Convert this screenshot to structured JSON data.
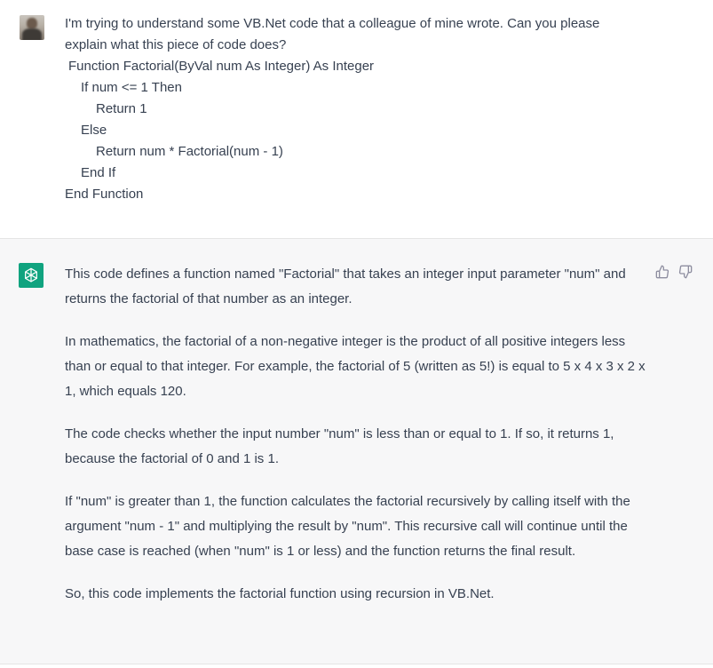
{
  "user_message": {
    "intro_line1": "I'm trying to understand some VB.Net code that a colleague of mine wrote. Can you please",
    "intro_line2": "explain what this piece of code does?",
    "code": [
      "Function Factorial(ByVal num As Integer) As Integer",
      "If num <= 1 Then",
      "Return 1",
      "Else",
      "Return num * Factorial(num - 1)",
      "End If",
      "End Function"
    ]
  },
  "assistant_message": {
    "paragraphs": [
      "This code defines a function named \"Factorial\" that takes an integer input parameter \"num\" and returns the factorial of that number as an integer.",
      "In mathematics, the factorial of a non-negative integer is the product of all positive integers less than or equal to that integer. For example, the factorial of 5 (written as 5!) is equal to 5 x 4 x 3 x 2 x 1, which equals 120.",
      "The code checks whether the input number \"num\" is less than or equal to 1. If so, it returns 1, because the factorial of 0 and 1 is 1.",
      "If \"num\" is greater than 1, the function calculates the factorial recursively by calling itself with the argument \"num - 1\" and multiplying the result by \"num\". This recursive call will continue until the base case is reached (when \"num\" is 1 or less) and the function returns the final result.",
      "So, this code implements the factorial function using recursion in VB.Net."
    ]
  },
  "icons": {
    "user_avatar": "user-avatar",
    "assistant_avatar": "openai-logo-icon",
    "thumbs_up": "thumbs-up-icon",
    "thumbs_down": "thumbs-down-icon"
  },
  "colors": {
    "assistant_bg": "#f7f7f8",
    "assistant_avatar_bg": "#10a37f",
    "text": "#374151",
    "icon": "#8e8ea0"
  }
}
